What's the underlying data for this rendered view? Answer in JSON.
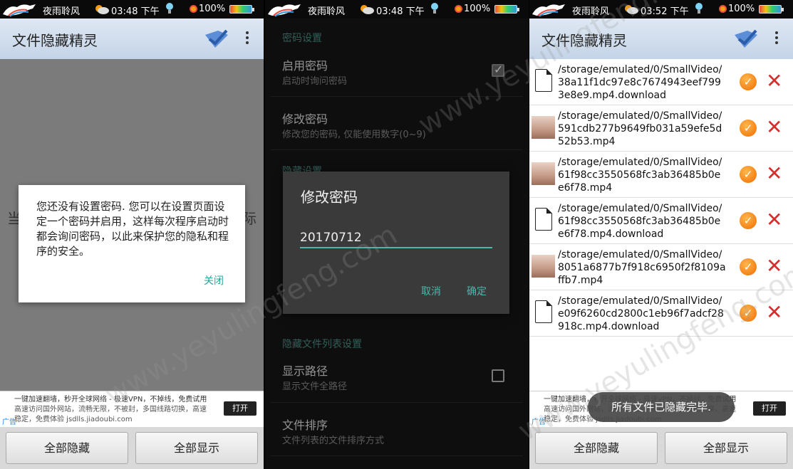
{
  "status": {
    "brand": "夜雨聆风",
    "battery": "100%"
  },
  "panel1": {
    "time": "03:48 下午",
    "app_title": "文件隐藏精灵",
    "ghost_left": "当",
    "ghost_right": "际",
    "dialog_message": "您还没有设置密码. 您可以在设置页面设定一个密码并启用，这样每次程序启动时都会询问密码，以此来保护您的隐私和程序的安全。",
    "dialog_close": "关闭",
    "ad": {
      "line1": "一键加速翻墙，秒开全球网络 - 极速VPN，不掉线，免费试用",
      "line2": "高速访问国外网站，流畅无限，不被封，多国线路切换，高速",
      "line3": "稳定，免费体验 jsdlls.jiadoubi.com",
      "tag": "广告",
      "open": "打开"
    },
    "hide_all": "全部隐藏",
    "show_all": "全部显示"
  },
  "panel2": {
    "time": "03:48 下午",
    "section_password": "密码设置",
    "enable_password_title": "启用密码",
    "enable_password_sub": "启动时询问密码",
    "change_password_title": "修改密码",
    "change_password_sub": "修改您的密码, 仅能使用数字(0~9)",
    "section_hidden": "隐藏设置",
    "section_list": "隐藏文件列表设置",
    "show_path_title": "显示路径",
    "show_path_sub": "显示文件全路径",
    "sort_title": "文件排序",
    "sort_sub": "文件列表的文件排序方式",
    "dialog_title": "修改密码",
    "dialog_value": "20170712",
    "dialog_cancel": "取消",
    "dialog_ok": "确定"
  },
  "panel3": {
    "time": "03:52 下午",
    "app_title": "文件隐藏精灵",
    "files": [
      {
        "path": "/storage/emulated/0/SmallVideo/38a11f1dc97e8c7674943eef7993e8e9.mp4.download",
        "thumb": "file"
      },
      {
        "path": "/storage/emulated/0/SmallVideo/591cdb277b9649fb031a59efe5d52b53.mp4",
        "thumb": "photo"
      },
      {
        "path": "/storage/emulated/0/SmallVideo/61f98cc3550568fc3ab36485b0ee6f78.mp4",
        "thumb": "photo"
      },
      {
        "path": "/storage/emulated/0/SmallVideo/61f98cc3550568fc3ab36485b0ee6f78.mp4.download",
        "thumb": "file"
      },
      {
        "path": "/storage/emulated/0/SmallVideo/8051a6877b7f918c6950f2f8109affb7.mp4",
        "thumb": "photo"
      },
      {
        "path": "/storage/emulated/0/SmallVideo/e09f6260cd2800c1eb96f7adcf28918c.mp4.download",
        "thumb": "file"
      }
    ],
    "toast": "所有文件已隐藏完毕.",
    "ad": {
      "line1": "一键加速翻墙，秒开全球网络 - 极速VPN，不掉线，免费试用",
      "line2": "高速访问国外网站，流畅无限，不被封，多国线路切换，高速",
      "line3": "稳定，免费体验 jsdlls.jiadoubi.com",
      "tag": "广告",
      "open": "打开"
    },
    "hide_all": "全部隐藏",
    "show_all": "全部显示"
  },
  "watermark": "www.yeyulingfeng.com"
}
